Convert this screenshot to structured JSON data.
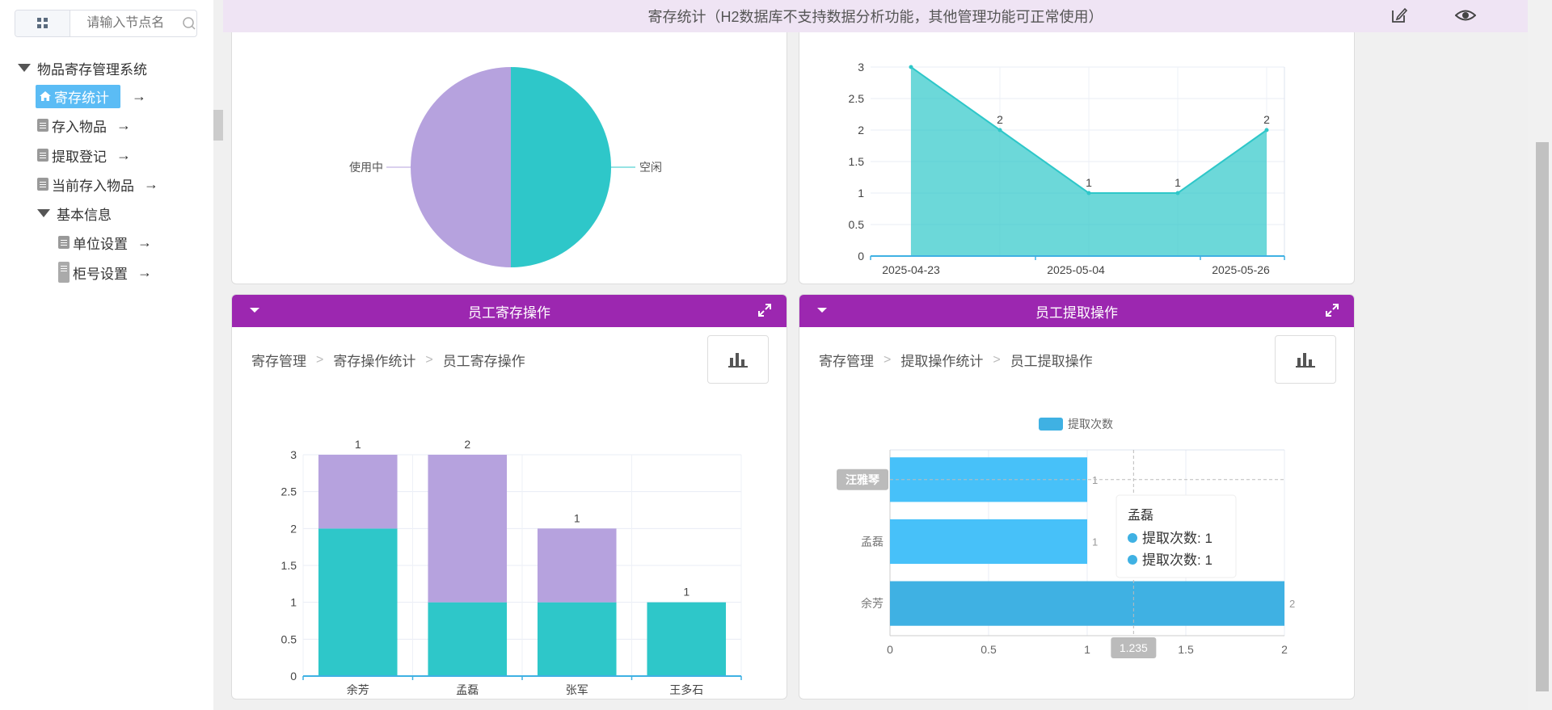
{
  "sidebar": {
    "search_placeholder": "请输入节点名",
    "tree": {
      "root": "物品寄存管理系统",
      "items": [
        {
          "label": "寄存统计",
          "arrow": "→"
        },
        {
          "label": "存入物品",
          "arrow": "→"
        },
        {
          "label": "提取登记",
          "arrow": "→"
        },
        {
          "label": "当前存入物品",
          "arrow": "→"
        }
      ],
      "group": "基本信息",
      "group_items": [
        {
          "label": "单位设置",
          "arrow": "→"
        },
        {
          "label": "柜号设置",
          "arrow": "→"
        }
      ]
    }
  },
  "topbar": {
    "title": "寄存统计（H2数据库不支持数据分析功能，其他管理功能可正常使用）"
  },
  "colors": {
    "accent": "#9c27b0",
    "teal": "#2ec7c9",
    "lavender": "#b6a2de",
    "blue": "#3fb1e3",
    "active": "#5bbcf5"
  },
  "panels": {
    "status_pie": {
      "chart_data": {
        "type": "pie",
        "categories": [
          "使用中",
          "空闲"
        ],
        "values": [
          1,
          1
        ],
        "colors": [
          "#b6a2de",
          "#2ec7c9"
        ]
      }
    },
    "trend_area": {
      "chart_data": {
        "type": "area",
        "x_ticks": [
          "2025-04-23",
          "2025-05-04",
          "2025-05-26"
        ],
        "y_ticks": [
          "0",
          "0.5",
          "1",
          "1.5",
          "2",
          "2.5",
          "3"
        ],
        "values": [
          3,
          2,
          1,
          1,
          2
        ],
        "labels": [
          "",
          "2",
          "1",
          "1",
          "2"
        ],
        "ylim": [
          0,
          3
        ]
      }
    },
    "staff_deposit": {
      "title": "员工寄存操作",
      "breadcrumb": [
        "寄存管理",
        "寄存操作统计",
        "员工寄存操作"
      ],
      "chart_data": {
        "type": "bar",
        "categories": [
          "余芳",
          "孟磊",
          "张军",
          "王多石"
        ],
        "y_ticks": [
          "0",
          "0.5",
          "1",
          "1.5",
          "2",
          "2.5",
          "3"
        ],
        "ylim": [
          0,
          3
        ],
        "series": [
          {
            "values": [
              2,
              1,
              1,
              1
            ],
            "labels": [
              "2",
              "1",
              "1",
              "1"
            ],
            "color": "#2ec7c9"
          },
          {
            "values": [
              1,
              2,
              1,
              0
            ],
            "labels": [
              "1",
              "2",
              "1",
              ""
            ],
            "color": "#b6a2de"
          }
        ]
      }
    },
    "staff_pickup": {
      "title": "员工提取操作",
      "breadcrumb": [
        "寄存管理",
        "提取操作统计",
        "员工提取操作"
      ],
      "chart_data": {
        "type": "bar",
        "orientation": "horizontal",
        "legend": "提取次数",
        "categories": [
          "汪雅琴",
          "孟磊",
          "余芳"
        ],
        "values": [
          1,
          1,
          2
        ],
        "value_labels": [
          "1",
          "1",
          "2"
        ],
        "x_ticks": [
          "0",
          "0.5",
          "1",
          "1.5",
          "2"
        ],
        "xlim": [
          0,
          2
        ],
        "axis_pointer": "1.235",
        "tooltip": {
          "title": "孟磊",
          "rows": [
            "提取次数:  1",
            "提取次数:  1"
          ]
        }
      }
    }
  }
}
